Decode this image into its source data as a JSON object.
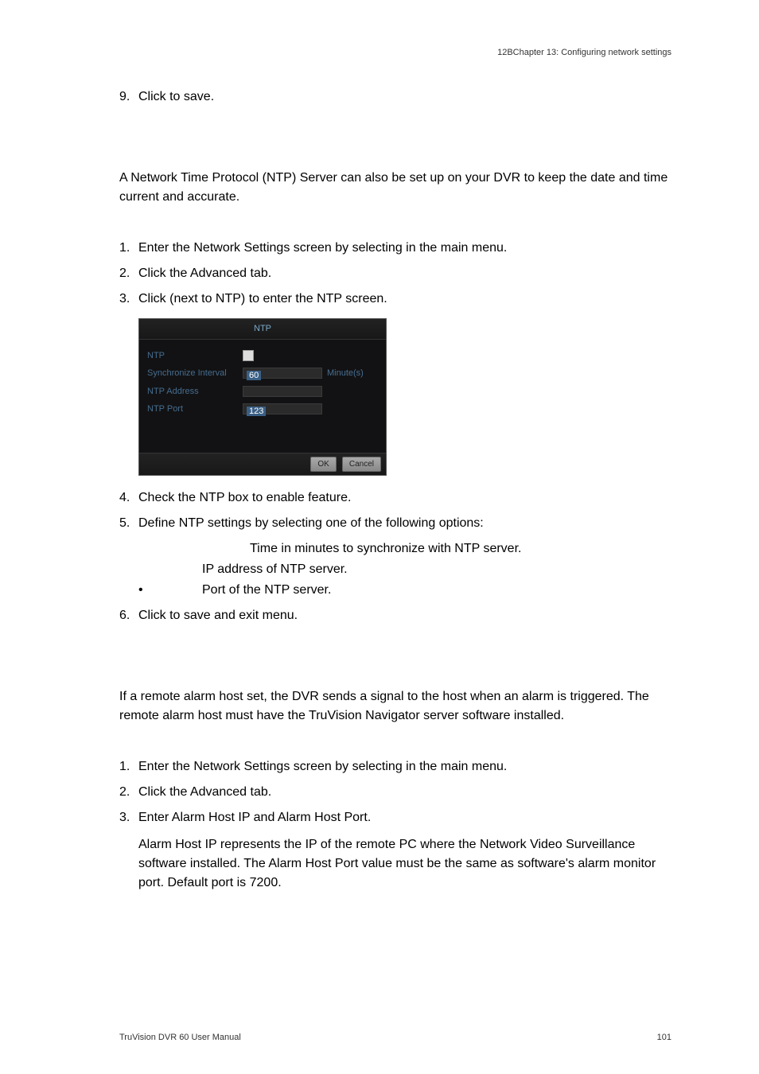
{
  "header": {
    "chapter": "12BChapter 13: Configuring network settings"
  },
  "steps1": {
    "n9": "9.",
    "t9a": "Click ",
    "t9b": " to save."
  },
  "ntp": {
    "para1": "A Network Time Protocol (NTP) Server can also be set up on your DVR to keep the date and time current and accurate.",
    "n1": "1.",
    "t1a": "Enter the Network Settings screen by selecting ",
    "t1b": " in the main menu.",
    "n2": "2.",
    "t2": "Click the Advanced tab.",
    "n3": "3.",
    "t3a": "Click ",
    "t3b": " (next to NTP) to enter the NTP screen.",
    "shot": {
      "title": "NTP",
      "label_ntp": "NTP",
      "label_sync": "Synchronize Interval",
      "value_sync": "60",
      "unit_sync": "Minute(s)",
      "label_addr": "NTP Address",
      "value_addr": "",
      "label_port": "NTP Port",
      "value_port": "123",
      "btn_ok": "OK",
      "btn_cancel": "Cancel"
    },
    "n4": "4.",
    "t4": "Check the NTP box to enable feature.",
    "n5": "5.",
    "t5": "Define NTP settings by selecting one of the following options:",
    "b1": "Time in minutes to synchronize with NTP server.",
    "b2": "IP address of NTP server.",
    "b3": "Port of the NTP server.",
    "n6": "6.",
    "t6a": "Click ",
    "t6b": " to save and exit menu."
  },
  "alarm": {
    "para1": "If a remote alarm host set, the DVR sends a signal to the host when an alarm is triggered. The remote alarm host must have the TruVision Navigator server software installed.",
    "n1": "1.",
    "t1a": "Enter the Network Settings screen by selecting ",
    "t1b": " in the main menu.",
    "n2": "2.",
    "t2": "Click the Advanced tab.",
    "n3": "3.",
    "t3": "Enter Alarm Host IP and Alarm Host Port.",
    "t3_detail": "Alarm Host IP represents the IP of the remote PC where the Network Video Surveillance software installed. The Alarm Host Port value must be the same as software's alarm monitor port. Default port is 7200."
  },
  "footer": {
    "left": "TruVision DVR 60 User Manual",
    "right": "101"
  }
}
